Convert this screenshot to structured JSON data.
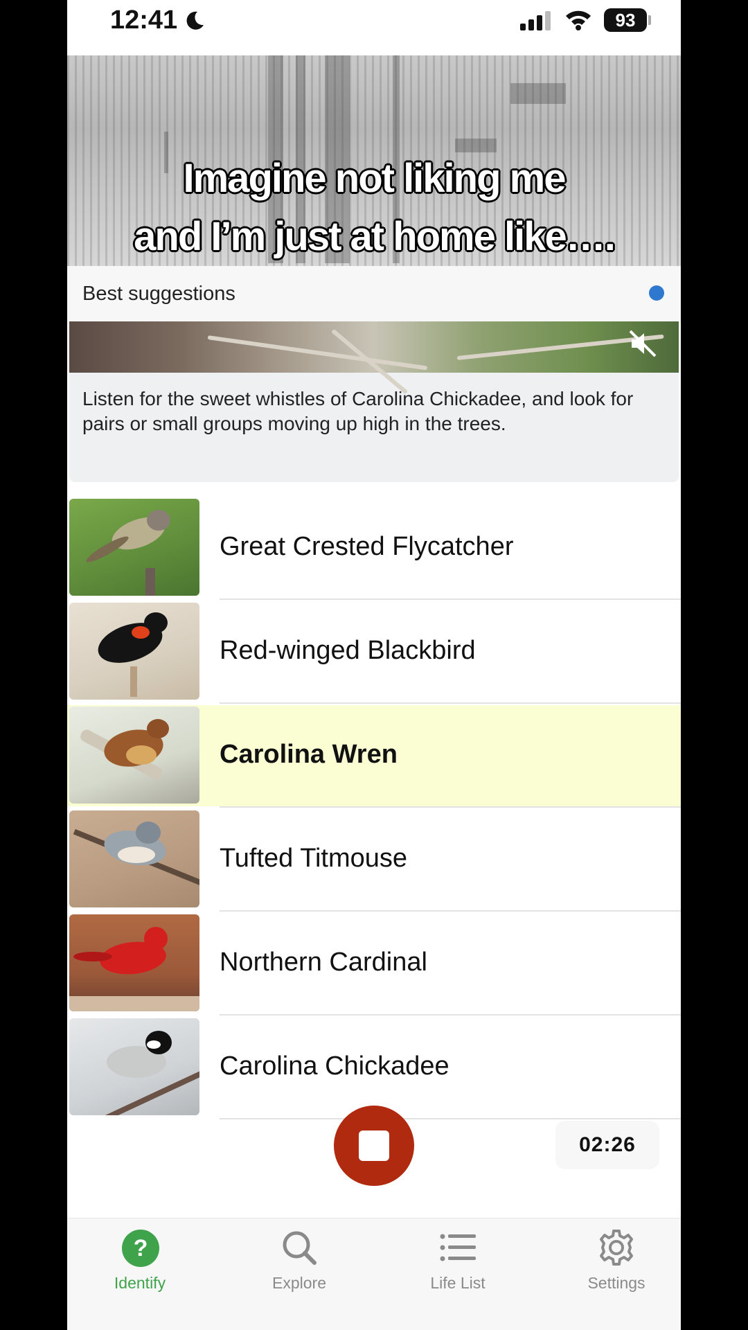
{
  "status_bar": {
    "time": "12:41",
    "battery": "93"
  },
  "caption": {
    "line1": "Imagine not liking me",
    "line2": "and I’m just at home like…."
  },
  "suggestions": {
    "header": "Best suggestions",
    "tip": "Listen for the sweet whistles of Carolina Chickadee, and look for pairs or small groups moving up high in the trees."
  },
  "birds": [
    {
      "name": "Great Crested Flycatcher"
    },
    {
      "name": "Red-winged Blackbird"
    },
    {
      "name": "Carolina Wren",
      "highlighted": true
    },
    {
      "name": "Tufted Titmouse"
    },
    {
      "name": "Northern Cardinal"
    },
    {
      "name": "Carolina Chickadee"
    }
  ],
  "recorder": {
    "timer": "02:26"
  },
  "tabs": [
    {
      "label": "Identify",
      "icon": "help-icon",
      "active": true
    },
    {
      "label": "Explore",
      "icon": "search-icon"
    },
    {
      "label": "Life List",
      "icon": "list-icon"
    },
    {
      "label": "Settings",
      "icon": "gear-icon"
    }
  ],
  "colors": {
    "accent_green": "#3ea34a",
    "stop_red": "#b02a10",
    "highlight": "#fbfdd2",
    "dot_blue": "#2f78d0"
  }
}
